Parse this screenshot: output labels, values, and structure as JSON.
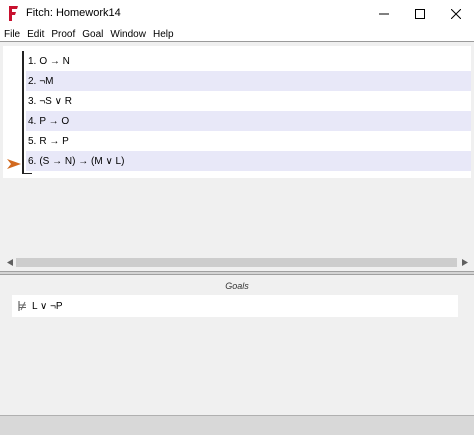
{
  "window": {
    "title": "Fitch: Homework14",
    "icon": "fitch-logo-icon",
    "controls": [
      "minimize-icon",
      "maximize-icon",
      "close-icon"
    ]
  },
  "menu": {
    "items": [
      "File",
      "Edit",
      "Proof",
      "Goal",
      "Window",
      "Help"
    ]
  },
  "proof": {
    "lines": [
      {
        "num": "1.",
        "formula": "O → N"
      },
      {
        "num": "2.",
        "formula": "¬M"
      },
      {
        "num": "3.",
        "formula": "¬S ∨ R"
      },
      {
        "num": "4.",
        "formula": "P → O"
      },
      {
        "num": "5.",
        "formula": "R → P"
      },
      {
        "num": "6.",
        "formula": "(S → N) → (M ∨ L)"
      }
    ],
    "current_line_marker": "current-step-arrow-icon",
    "marker_color": "#d2691e",
    "alt_row_color": "#e8e8f8"
  },
  "goals": {
    "header": "Goals",
    "items": [
      {
        "icon": "not-proved-icon",
        "formula": "L ∨ ¬P"
      }
    ]
  }
}
